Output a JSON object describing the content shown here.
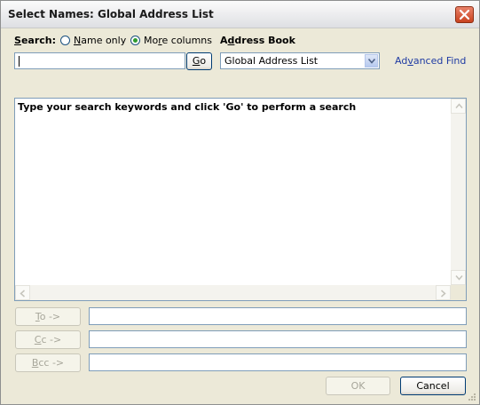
{
  "window": {
    "title": "Select Names: Global Address List",
    "close_icon": "close-icon"
  },
  "search": {
    "label": "Search:",
    "label_mnemonic": "S",
    "label_rest": "earch:",
    "options": [
      {
        "label": "Name only",
        "mnemonic": "N",
        "rest": "ame only",
        "selected": false
      },
      {
        "label": "More columns",
        "pre": "Mo",
        "mnemonic": "r",
        "rest": "e columns",
        "selected": true
      }
    ],
    "input_value": "",
    "go": {
      "label": "Go",
      "mnemonic": "G",
      "rest": "o"
    }
  },
  "address_book": {
    "label": "Address Book",
    "pre": "A",
    "mnemonic": "d",
    "rest": "dress Book",
    "selected": "Global Address List"
  },
  "advanced_find": {
    "label": "Advanced Find",
    "pre": "Ad",
    "mnemonic": "v",
    "rest": "anced Find"
  },
  "results": {
    "message": "Type your search keywords and click 'Go' to perform a search"
  },
  "recipients": [
    {
      "label": "To ->",
      "mnemonic": "T",
      "rest": "o ->",
      "value": ""
    },
    {
      "label": "Cc ->",
      "mnemonic": "C",
      "rest": "c ->",
      "value": ""
    },
    {
      "label": "Bcc ->",
      "mnemonic": "B",
      "rest": "cc ->",
      "value": ""
    }
  ],
  "footer": {
    "ok": "OK",
    "cancel": "Cancel"
  },
  "colors": {
    "link": "#1f3ba3",
    "dialog_bg": "#ece9d8",
    "close_red": "#c9421f"
  }
}
